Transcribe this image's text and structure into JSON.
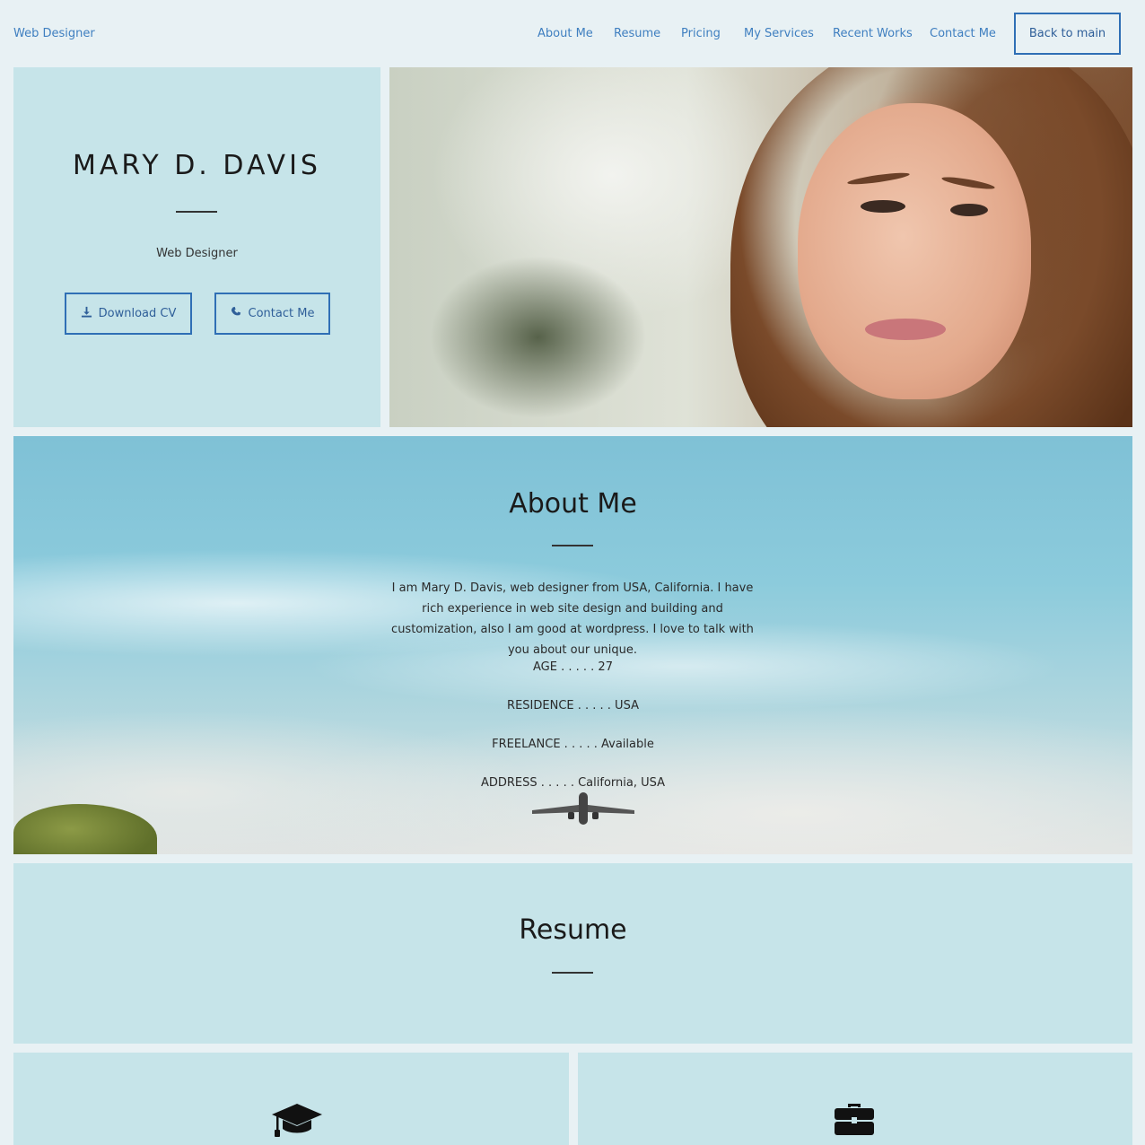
{
  "nav": {
    "brand": "Web Designer",
    "items": [
      "About Me",
      "Resume",
      "Pricing",
      "My Services",
      "Recent Works",
      "Contact Me"
    ],
    "back_label": "Back to main"
  },
  "hero": {
    "name": "MARY D. DAVIS",
    "role": "Web Designer",
    "download_label": "Download CV",
    "contact_label": "Contact Me",
    "download_icon": "download-icon",
    "contact_icon": "phone-icon"
  },
  "about": {
    "title": "About Me",
    "bio": "I am Mary D. Davis, web designer from USA, California. I have rich experience in web site design and building and customization, also I am good at wordpress. I love to talk with you about our unique.",
    "facts": [
      "AGE . . . . . 27",
      "RESIDENCE . . . . . USA",
      "FREELANCE . . . . . Available",
      "ADDRESS . . . . . California, USA"
    ]
  },
  "resume": {
    "title": "Resume",
    "icons": [
      "graduation-cap-icon",
      "briefcase-icon"
    ]
  },
  "colors": {
    "page_bg": "#e8f1f4",
    "panel_bg": "#c6e4e9",
    "accent": "#2f6fb5",
    "link": "#3f7fc0"
  }
}
